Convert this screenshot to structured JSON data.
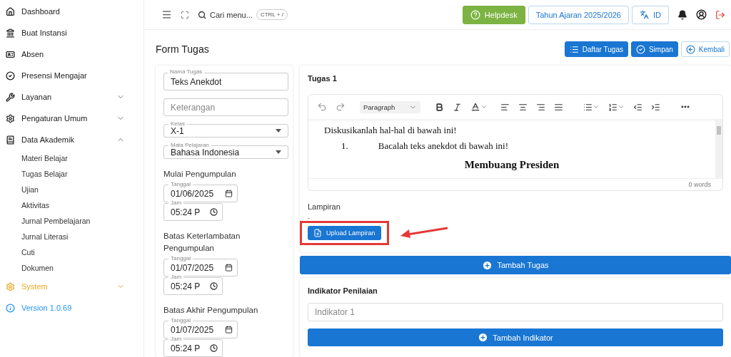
{
  "sidebar": {
    "items": [
      {
        "label": "Dashboard",
        "color": "#212121"
      },
      {
        "label": "Buat Instansi",
        "color": "#212121"
      },
      {
        "label": "Absen",
        "color": "#212121"
      },
      {
        "label": "Presensi Mengajar",
        "color": "#212121"
      },
      {
        "label": "Layanan",
        "color": "#212121",
        "expanded": false
      },
      {
        "label": "Pengaturan Umum",
        "color": "#212121",
        "expanded": false
      },
      {
        "label": "Data Akademik",
        "color": "#212121",
        "expanded": true,
        "children": [
          {
            "label": "Materi Belajar"
          },
          {
            "label": "Tugas Belajar"
          },
          {
            "label": "Ujian"
          },
          {
            "label": "Aktivitas"
          },
          {
            "label": "Jurnal Pembelajaran"
          },
          {
            "label": "Jurnal Literasi"
          },
          {
            "label": "Cuti"
          },
          {
            "label": "Dokumen"
          }
        ]
      },
      {
        "label": "System",
        "color": "#f5a623",
        "expanded": false
      },
      {
        "label": "Version 1.0.69",
        "color": "#2196f3"
      }
    ]
  },
  "header": {
    "search": {
      "placeholder": "Cari menu...",
      "shortcut": "CTRL + /"
    },
    "helpdesk": "Helpdesk",
    "school_year": "Tahun Ajaran 2025/2026",
    "language": "ID"
  },
  "page": {
    "title": "Form Tugas",
    "actions": [
      {
        "label": "Daftar Tugas",
        "kind": "primary"
      },
      {
        "label": "Simpan",
        "kind": "primary"
      },
      {
        "label": "Kembali",
        "kind": "outline"
      }
    ]
  },
  "form": {
    "fields": [
      {
        "kind": "text",
        "label": "Nama Tugas",
        "value": "Teks Anekdot"
      },
      {
        "kind": "text",
        "placeholder": "Keterangan"
      },
      {
        "kind": "select",
        "label": "Kelas",
        "value": "X-1"
      },
      {
        "kind": "select",
        "label": "Mata Pelajaran",
        "value": "Bahasa Indonesia"
      }
    ],
    "schedules": [
      {
        "title": "Mulai Pengumpulan",
        "date_label": "Tanggal",
        "date": "01/06/2025",
        "time_label": "Jam",
        "time": "05:24 P"
      },
      {
        "title": "Batas Keterlambatan Pengumpulan",
        "date_label": "Tanggal",
        "date": "01/07/2025",
        "time_label": "Jam",
        "time": "05:24 P"
      },
      {
        "title": "Batas Akhir Pengumpulan",
        "date_label": "Tanggal",
        "date": "01/07/2025",
        "time_label": "Jam",
        "time": "05:24 P"
      }
    ]
  },
  "task": {
    "title": "Tugas 1",
    "editor": {
      "block_format": "Paragraph",
      "content": [
        {
          "kind": "paragraph",
          "text": "Diskusikanlah hal-hal di bawah ini!"
        },
        {
          "kind": "list_item",
          "number": "1.",
          "text": "Bacalah teks anekdot di bawah ini!"
        },
        {
          "kind": "heading",
          "text": "Membuang Presiden"
        }
      ],
      "word_count": "0 words"
    },
    "attachment": {
      "label": "Lampiran",
      "value": "-",
      "button": "Upload Lampiran",
      "highlighted": true
    }
  },
  "add_task_button": "Tambah Tugas",
  "indicators": {
    "title": "Indikator Penilaian",
    "inputs": [
      {
        "placeholder": "Indikator 1"
      }
    ],
    "add_button": "Tambah Indikator"
  }
}
